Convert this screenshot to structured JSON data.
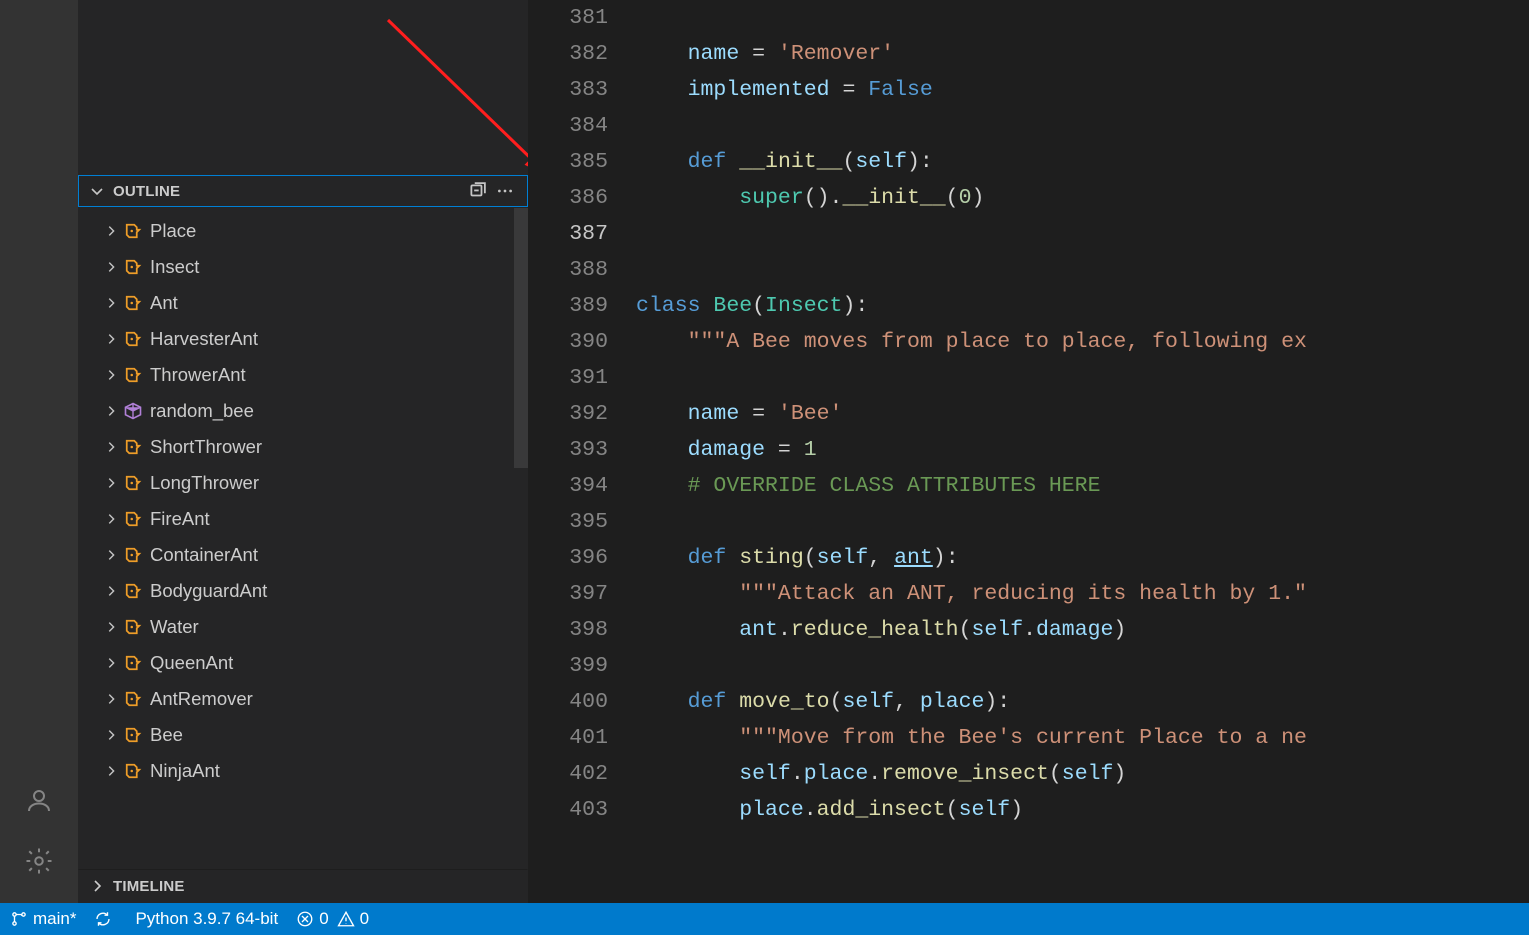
{
  "sidebar": {
    "outline_title": "OUTLINE",
    "timeline_title": "TIMELINE",
    "items": [
      {
        "label": "Place",
        "kind": "class"
      },
      {
        "label": "Insect",
        "kind": "class"
      },
      {
        "label": "Ant",
        "kind": "class"
      },
      {
        "label": "HarvesterAnt",
        "kind": "class"
      },
      {
        "label": "ThrowerAnt",
        "kind": "class"
      },
      {
        "label": "random_bee",
        "kind": "variable"
      },
      {
        "label": "ShortThrower",
        "kind": "class"
      },
      {
        "label": "LongThrower",
        "kind": "class"
      },
      {
        "label": "FireAnt",
        "kind": "class"
      },
      {
        "label": "ContainerAnt",
        "kind": "class"
      },
      {
        "label": "BodyguardAnt",
        "kind": "class"
      },
      {
        "label": "Water",
        "kind": "class"
      },
      {
        "label": "QueenAnt",
        "kind": "class"
      },
      {
        "label": "AntRemover",
        "kind": "class"
      },
      {
        "label": "Bee",
        "kind": "class"
      },
      {
        "label": "NinjaAnt",
        "kind": "class"
      }
    ]
  },
  "editor": {
    "current_line": 387,
    "lines": [
      {
        "n": 381,
        "tokens": []
      },
      {
        "n": 382,
        "tokens": [
          {
            "t": "    ",
            "c": "def"
          },
          {
            "t": "name",
            "c": "self"
          },
          {
            "t": " = ",
            "c": "def"
          },
          {
            "t": "'Remover'",
            "c": "str"
          }
        ]
      },
      {
        "n": 383,
        "tokens": [
          {
            "t": "    ",
            "c": "def"
          },
          {
            "t": "implemented",
            "c": "self"
          },
          {
            "t": " = ",
            "c": "def"
          },
          {
            "t": "False",
            "c": "const"
          }
        ]
      },
      {
        "n": 384,
        "tokens": []
      },
      {
        "n": 385,
        "tokens": [
          {
            "t": "    ",
            "c": "def"
          },
          {
            "t": "def",
            "c": "kw"
          },
          {
            "t": " ",
            "c": "def"
          },
          {
            "t": "__init__",
            "c": "mag"
          },
          {
            "t": "(",
            "c": "def"
          },
          {
            "t": "self",
            "c": "self"
          },
          {
            "t": "):",
            "c": "def"
          }
        ]
      },
      {
        "n": 386,
        "tokens": [
          {
            "t": "        ",
            "c": "def"
          },
          {
            "t": "super",
            "c": "cls"
          },
          {
            "t": "().",
            "c": "def"
          },
          {
            "t": "__init__",
            "c": "mag"
          },
          {
            "t": "(",
            "c": "def"
          },
          {
            "t": "0",
            "c": "num"
          },
          {
            "t": ")",
            "c": "def"
          }
        ]
      },
      {
        "n": 387,
        "tokens": []
      },
      {
        "n": 388,
        "tokens": []
      },
      {
        "n": 389,
        "tokens": [
          {
            "t": "class",
            "c": "kw"
          },
          {
            "t": " ",
            "c": "def"
          },
          {
            "t": "Bee",
            "c": "cls"
          },
          {
            "t": "(",
            "c": "def"
          },
          {
            "t": "Insect",
            "c": "cls"
          },
          {
            "t": "):",
            "c": "def"
          }
        ]
      },
      {
        "n": 390,
        "tokens": [
          {
            "t": "    ",
            "c": "def"
          },
          {
            "t": "\"\"\"A Bee moves from place to place, following ex",
            "c": "str"
          }
        ]
      },
      {
        "n": 391,
        "tokens": []
      },
      {
        "n": 392,
        "tokens": [
          {
            "t": "    ",
            "c": "def"
          },
          {
            "t": "name",
            "c": "self"
          },
          {
            "t": " = ",
            "c": "def"
          },
          {
            "t": "'Bee'",
            "c": "str"
          }
        ]
      },
      {
        "n": 393,
        "tokens": [
          {
            "t": "    ",
            "c": "def"
          },
          {
            "t": "damage",
            "c": "self"
          },
          {
            "t": " = ",
            "c": "def"
          },
          {
            "t": "1",
            "c": "num"
          }
        ]
      },
      {
        "n": 394,
        "tokens": [
          {
            "t": "    ",
            "c": "def"
          },
          {
            "t": "# OVERRIDE CLASS ATTRIBUTES HERE",
            "c": "cmnt"
          }
        ]
      },
      {
        "n": 395,
        "tokens": []
      },
      {
        "n": 396,
        "tokens": [
          {
            "t": "    ",
            "c": "def"
          },
          {
            "t": "def",
            "c": "kw"
          },
          {
            "t": " ",
            "c": "def"
          },
          {
            "t": "sting",
            "c": "fn"
          },
          {
            "t": "(",
            "c": "def"
          },
          {
            "t": "self",
            "c": "self"
          },
          {
            "t": ", ",
            "c": "def"
          },
          {
            "t": "ant",
            "c": "paramu"
          },
          {
            "t": "):",
            "c": "def"
          }
        ]
      },
      {
        "n": 397,
        "tokens": [
          {
            "t": "        ",
            "c": "def"
          },
          {
            "t": "\"\"\"Attack an ANT, reducing its health by 1.\"",
            "c": "str"
          }
        ]
      },
      {
        "n": 398,
        "tokens": [
          {
            "t": "        ",
            "c": "def"
          },
          {
            "t": "ant",
            "c": "self"
          },
          {
            "t": ".",
            "c": "def"
          },
          {
            "t": "reduce_health",
            "c": "fn"
          },
          {
            "t": "(",
            "c": "def"
          },
          {
            "t": "self",
            "c": "self"
          },
          {
            "t": ".",
            "c": "def"
          },
          {
            "t": "damage",
            "c": "self"
          },
          {
            "t": ")",
            "c": "def"
          }
        ]
      },
      {
        "n": 399,
        "tokens": []
      },
      {
        "n": 400,
        "tokens": [
          {
            "t": "    ",
            "c": "def"
          },
          {
            "t": "def",
            "c": "kw"
          },
          {
            "t": " ",
            "c": "def"
          },
          {
            "t": "move_to",
            "c": "fn"
          },
          {
            "t": "(",
            "c": "def"
          },
          {
            "t": "self",
            "c": "self"
          },
          {
            "t": ", ",
            "c": "def"
          },
          {
            "t": "place",
            "c": "param"
          },
          {
            "t": "):",
            "c": "def"
          }
        ]
      },
      {
        "n": 401,
        "tokens": [
          {
            "t": "        ",
            "c": "def"
          },
          {
            "t": "\"\"\"Move from the Bee's current Place to a ne",
            "c": "str"
          }
        ]
      },
      {
        "n": 402,
        "tokens": [
          {
            "t": "        ",
            "c": "def"
          },
          {
            "t": "self",
            "c": "self"
          },
          {
            "t": ".",
            "c": "def"
          },
          {
            "t": "place",
            "c": "self"
          },
          {
            "t": ".",
            "c": "def"
          },
          {
            "t": "remove_insect",
            "c": "fn"
          },
          {
            "t": "(",
            "c": "def"
          },
          {
            "t": "self",
            "c": "self"
          },
          {
            "t": ")",
            "c": "def"
          }
        ]
      },
      {
        "n": 403,
        "tokens": [
          {
            "t": "        ",
            "c": "def"
          },
          {
            "t": "place",
            "c": "self"
          },
          {
            "t": ".",
            "c": "def"
          },
          {
            "t": "add_insect",
            "c": "fn"
          },
          {
            "t": "(",
            "c": "def"
          },
          {
            "t": "self",
            "c": "self"
          },
          {
            "t": ")",
            "c": "def"
          }
        ]
      }
    ]
  },
  "statusbar": {
    "branch": "main*",
    "interpreter": "Python 3.9.7 64-bit",
    "errors": "0",
    "warnings": "0"
  }
}
